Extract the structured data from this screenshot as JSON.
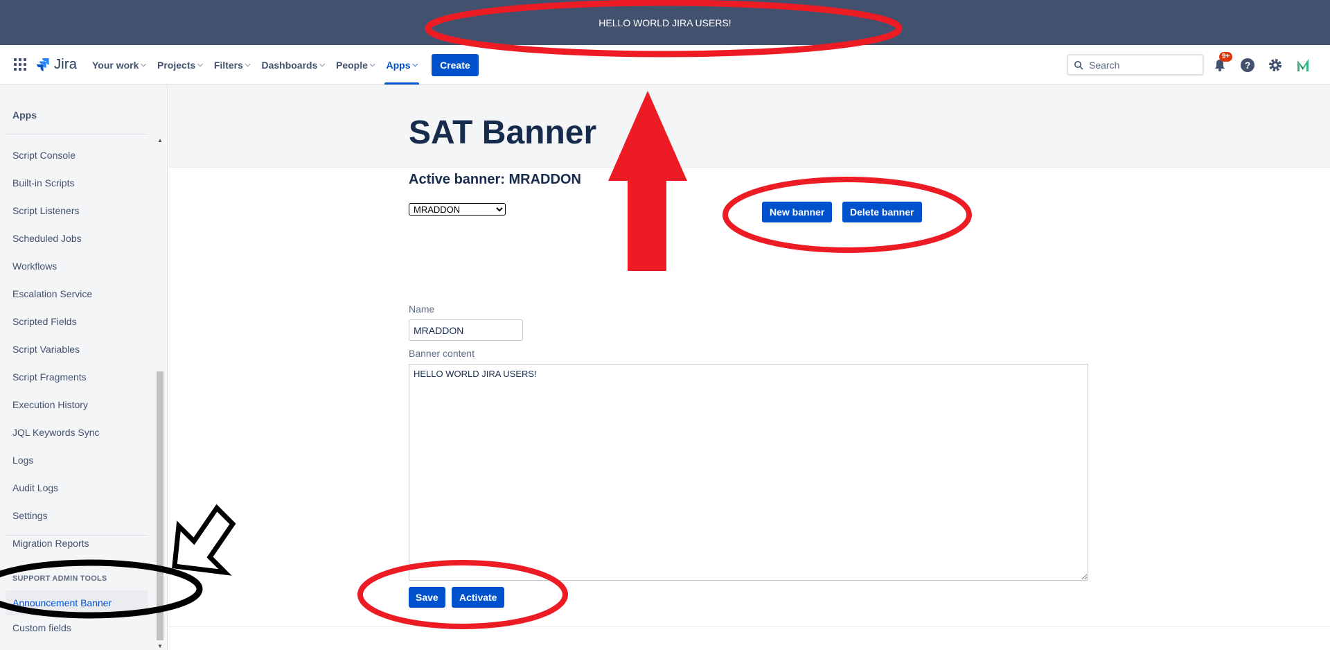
{
  "announcement": {
    "text": "HELLO WORLD JIRA USERS!"
  },
  "topnav": {
    "logo_text": "Jira",
    "items": [
      {
        "label": "Your work",
        "active": false
      },
      {
        "label": "Projects",
        "active": false
      },
      {
        "label": "Filters",
        "active": false
      },
      {
        "label": "Dashboards",
        "active": false
      },
      {
        "label": "People",
        "active": false
      },
      {
        "label": "Apps",
        "active": true
      }
    ],
    "create_label": "Create",
    "search_placeholder": "Search",
    "notification_badge": "9+",
    "accent_color": "#0052cc"
  },
  "sidebar": {
    "title": "Apps",
    "items": [
      "Script Console",
      "Built-in Scripts",
      "Script Listeners",
      "Scheduled Jobs",
      "Workflows",
      "Escalation Service",
      "Scripted Fields",
      "Script Variables",
      "Script Fragments",
      "Execution History",
      "JQL Keywords Sync",
      "Logs",
      "Audit Logs",
      "Settings",
      "Migration Reports"
    ],
    "section_label": "SUPPORT ADMIN TOOLS",
    "selected_item": "Announcement Banner",
    "after_item": "Custom fields"
  },
  "main": {
    "page_title": "SAT Banner",
    "active_banner_text": "Active banner: MRADDON",
    "banner_select_value": "MRADDON",
    "new_banner_label": "New banner",
    "delete_banner_label": "Delete banner",
    "name_label": "Name",
    "name_value": "MRADDON",
    "content_label": "Banner content",
    "content_value": "HELLO WORLD JIRA USERS!",
    "save_label": "Save",
    "activate_label": "Activate"
  },
  "annotation_colors": {
    "red": "#ed1c24",
    "black": "#000000"
  }
}
